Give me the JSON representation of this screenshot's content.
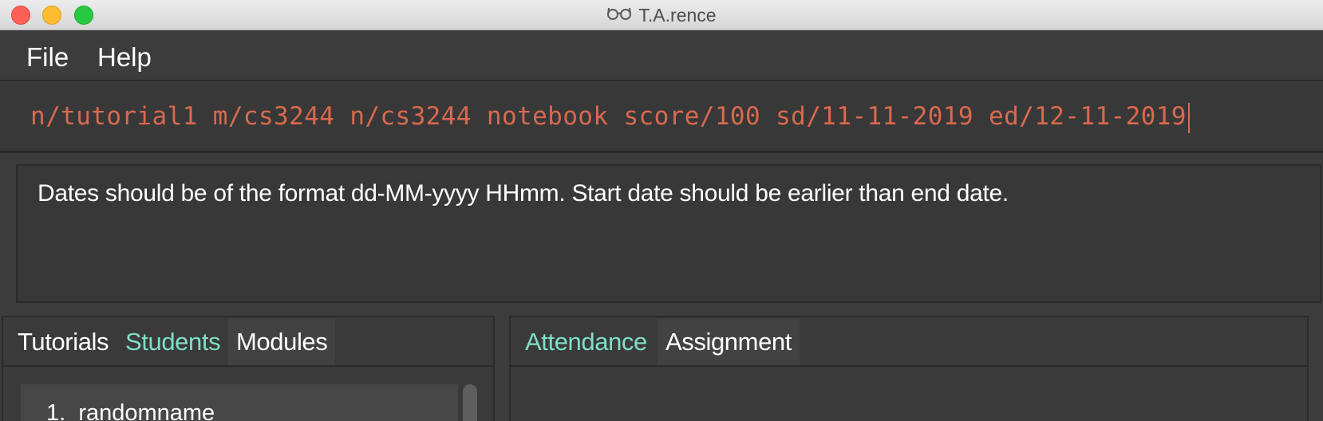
{
  "window": {
    "title": "T.A.rence",
    "icon": "glasses-icon"
  },
  "menubar": {
    "items": [
      "File",
      "Help"
    ]
  },
  "command_box": {
    "value": "n/tutorial1 m/cs3244 n/cs3244 notebook score/100 sd/11-11-2019 ed/12-11-2019",
    "text_color": "#d9694f"
  },
  "result_box": {
    "message": "Dates should be of the format dd-MM-yyyy HHmm. Start date should be earlier than end date."
  },
  "left_panel": {
    "tabs": [
      "Tutorials",
      "Students",
      "Modules"
    ],
    "selected_tab": "Students",
    "list": [
      {
        "index": "1.",
        "name": "randomname"
      }
    ]
  },
  "right_panel": {
    "tabs": [
      "Attendance",
      "Assignment"
    ],
    "selected_tab": "Attendance"
  },
  "colors": {
    "accent_selected_tab": "#7fe0c4",
    "background": "#3c3c3c"
  }
}
